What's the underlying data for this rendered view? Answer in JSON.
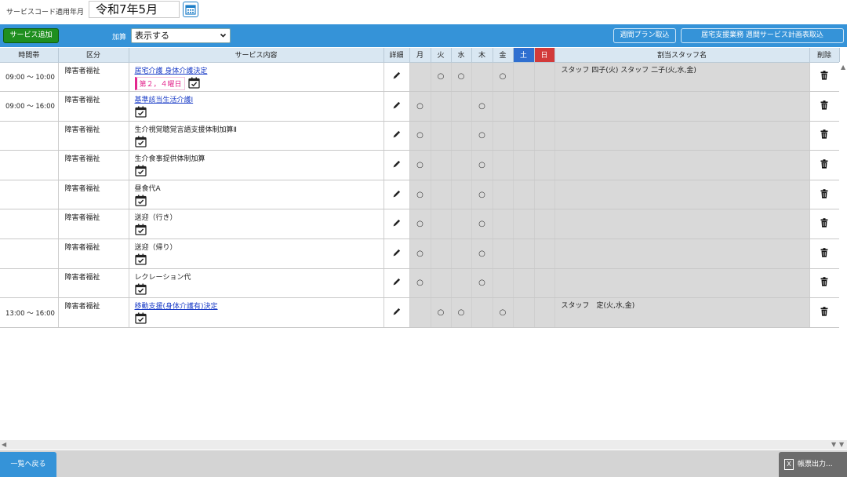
{
  "header": {
    "applied_month_label": "サービスコード適用年月",
    "applied_month_value": "令和7年5月"
  },
  "toolbar": {
    "add_service_label": "サービス追加",
    "kasan_label": "加算",
    "kasan_value": "表示する",
    "import_week_plan_label": "週間プラン取込",
    "import_home_support_label": "居宅支援業務 週間サービス計画表取込"
  },
  "table": {
    "columns": {
      "time": "時間帯",
      "kubun": "区分",
      "service": "サービス内容",
      "detail": "詳細",
      "mon": "月",
      "tue": "火",
      "wed": "水",
      "thu": "木",
      "fri": "金",
      "sat": "土",
      "sun": "日",
      "staff": "割当スタッフ名",
      "delete": "削除"
    },
    "mark": "○",
    "rows": [
      {
        "time": "09:00 〜 10:00",
        "kubun": "障害者福祉",
        "service": "居宅介護 身体介護決定",
        "badge": "第２，４曜日",
        "staff": "スタッフ 四子(火) スタッフ 二子(火,水,金)"
      },
      {
        "time": "09:00 〜 16:00",
        "kubun": "障害者福祉",
        "service": "基準該当生活介護Ⅰ",
        "staff": ""
      },
      {
        "time": "",
        "kubun": "障害者福祉",
        "service": "生介視覚聴覚言語支援体制加算Ⅱ",
        "staff": ""
      },
      {
        "time": "",
        "kubun": "障害者福祉",
        "service": "生介食事提供体制加算",
        "staff": ""
      },
      {
        "time": "",
        "kubun": "障害者福祉",
        "service": "昼食代A",
        "staff": ""
      },
      {
        "time": "",
        "kubun": "障害者福祉",
        "service": "送迎（行き）",
        "staff": ""
      },
      {
        "time": "",
        "kubun": "障害者福祉",
        "service": "送迎（帰り）",
        "staff": ""
      },
      {
        "time": "",
        "kubun": "障害者福祉",
        "service": "レクレーション代",
        "staff": ""
      },
      {
        "time": "13:00 〜 16:00",
        "kubun": "障害者福祉",
        "service": "移動支援(身体介護有)決定",
        "staff": "スタッフ　定(火,水,金)"
      }
    ]
  },
  "footer": {
    "back_label": "一覧へ戻る",
    "report_label": "帳票出力..."
  },
  "icons": {
    "calendar": "calendar-icon",
    "edit": "pencil-icon",
    "delete": "trash-icon",
    "report": "excel-file-icon"
  },
  "colors": {
    "toolbar_blue": "#3593d8",
    "add_green": "#1f8f1f",
    "saturday_blue": "#2f6fd0",
    "sunday_red": "#d23a3a",
    "badge_pink": "#e3278e",
    "link_blue": "#1a3cc7"
  }
}
